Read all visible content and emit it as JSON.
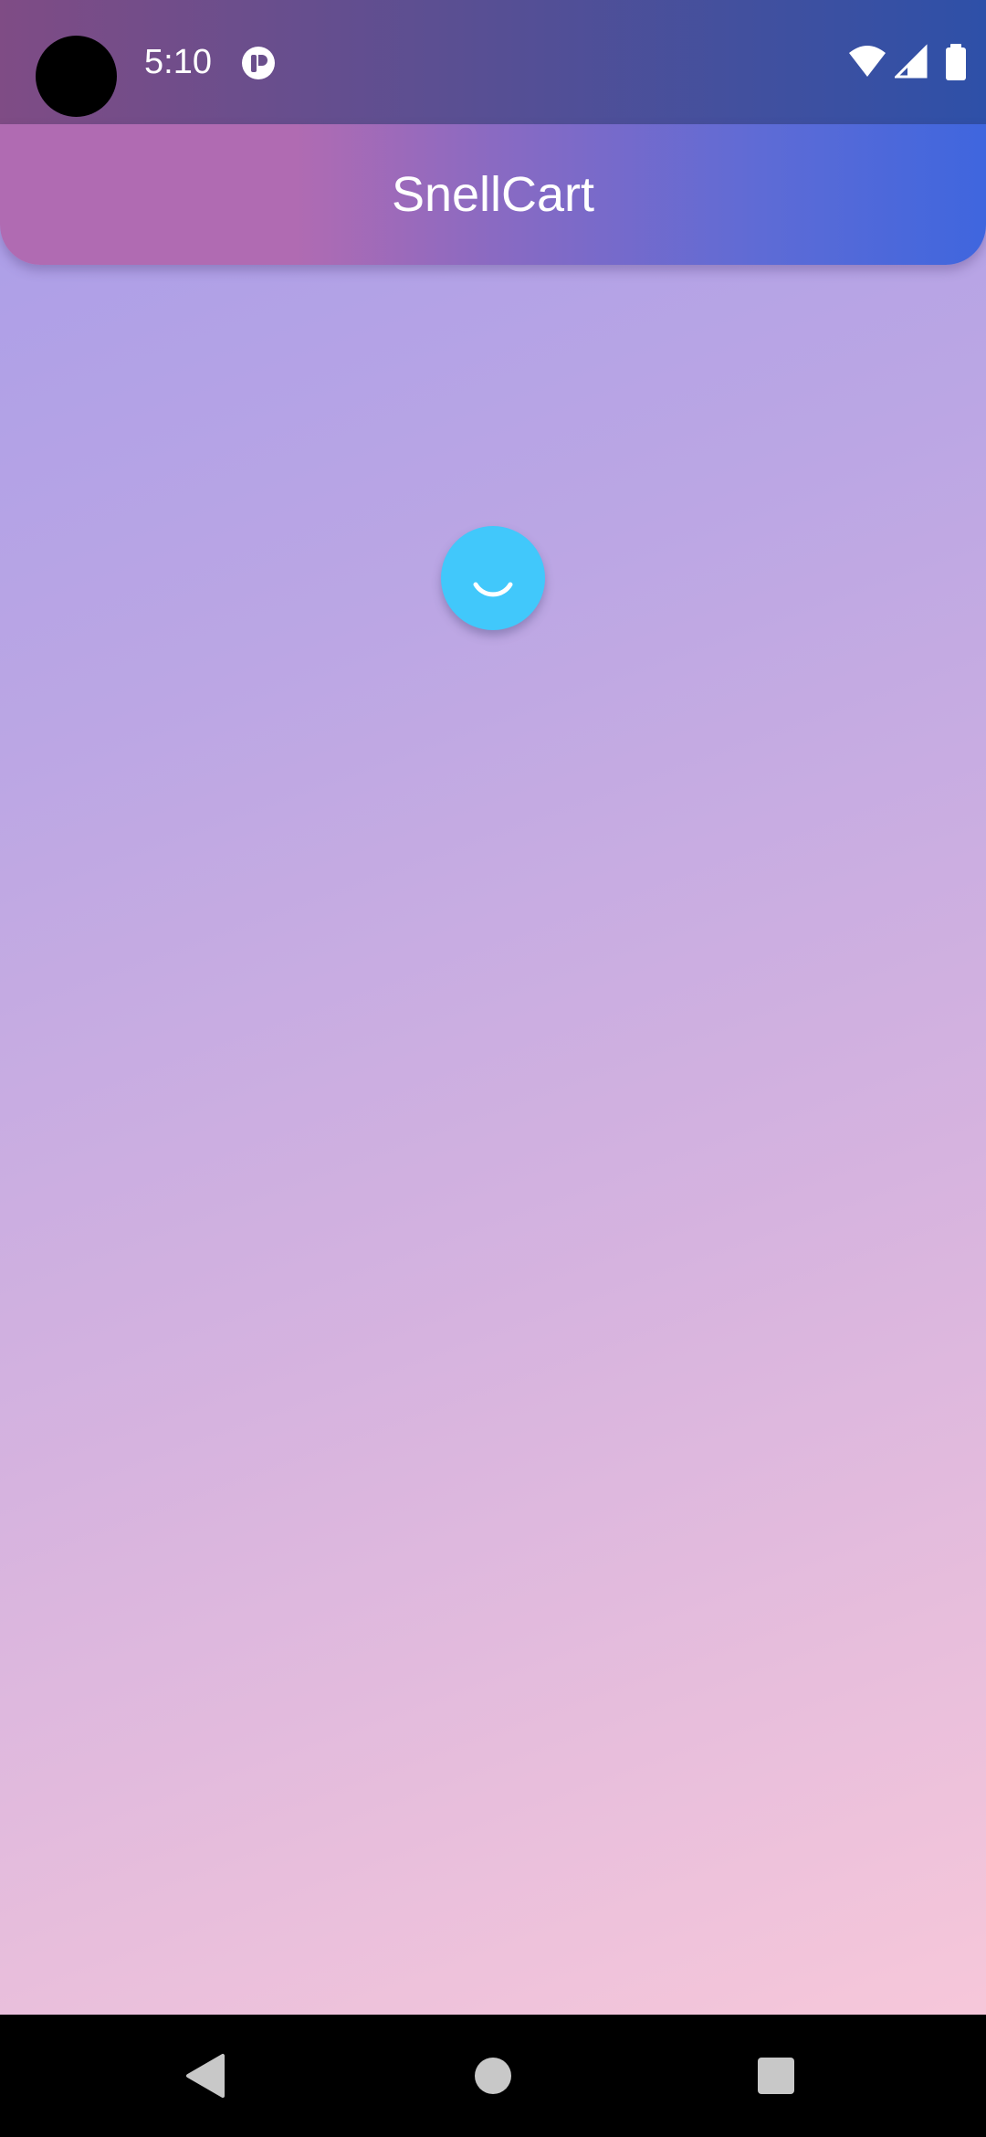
{
  "status_bar": {
    "time": "5:10",
    "icons": [
      "camera-cutout",
      "notification-icon",
      "wifi-icon",
      "cellular-signal-icon",
      "battery-icon"
    ]
  },
  "app_bar": {
    "title": "SnellCart"
  },
  "content": {
    "loading_indicator": "spinner"
  },
  "nav_bar": {
    "buttons": [
      "back-icon",
      "home-icon",
      "recents-icon"
    ]
  },
  "colors": {
    "spinner": "#41c8fb",
    "app_bar_start": "#b06bb2",
    "app_bar_end": "#3f66de",
    "background_top": "#a79ce9",
    "background_bottom": "#fbcad9"
  }
}
